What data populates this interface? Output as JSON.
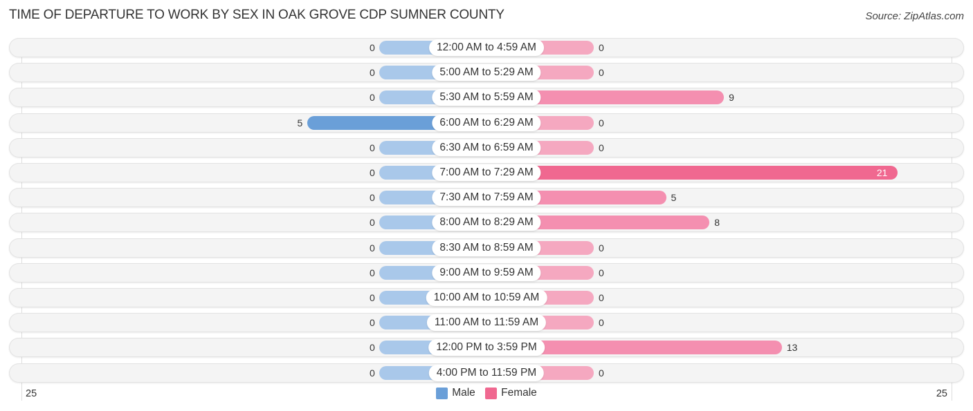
{
  "chart_data": {
    "type": "bar",
    "orientation": "horizontal-diverging",
    "title": "TIME OF DEPARTURE TO WORK BY SEX IN OAK GROVE CDP SUMNER COUNTY",
    "source": "Source: ZipAtlas.com",
    "categories": [
      "12:00 AM to 4:59 AM",
      "5:00 AM to 5:29 AM",
      "5:30 AM to 5:59 AM",
      "6:00 AM to 6:29 AM",
      "6:30 AM to 6:59 AM",
      "7:00 AM to 7:29 AM",
      "7:30 AM to 7:59 AM",
      "8:00 AM to 8:29 AM",
      "8:30 AM to 8:59 AM",
      "9:00 AM to 9:59 AM",
      "10:00 AM to 10:59 AM",
      "11:00 AM to 11:59 AM",
      "12:00 PM to 3:59 PM",
      "4:00 PM to 11:59 PM"
    ],
    "series": [
      {
        "name": "Male",
        "color": "#6a9fd8",
        "light_color": "#a9c8ea",
        "values": [
          0,
          0,
          0,
          5,
          0,
          0,
          0,
          0,
          0,
          0,
          0,
          0,
          0,
          0
        ]
      },
      {
        "name": "Female",
        "color": "#f06890",
        "light_color": "#f5a8c0",
        "values": [
          0,
          0,
          9,
          0,
          0,
          21,
          5,
          8,
          0,
          0,
          0,
          0,
          13,
          0
        ]
      }
    ],
    "axis": {
      "left_tick": "25",
      "right_tick": "25",
      "range": [
        0,
        25
      ]
    },
    "legend": {
      "position": "bottom-center",
      "items": [
        "Male",
        "Female"
      ]
    },
    "grid": false
  }
}
